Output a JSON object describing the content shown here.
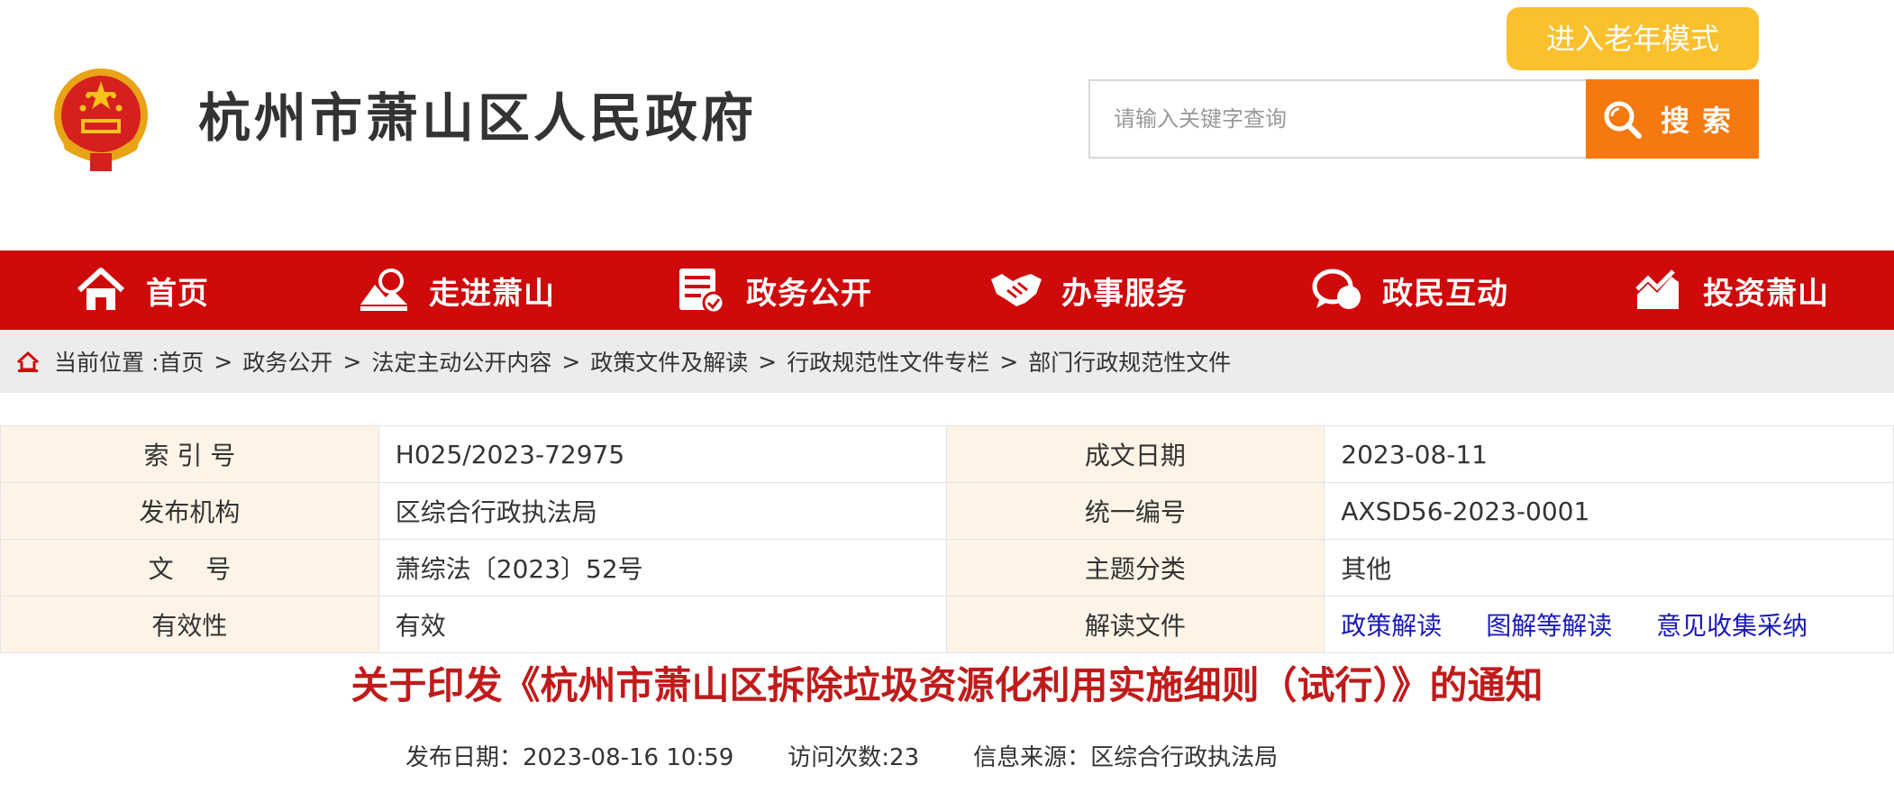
{
  "header": {
    "site_title": "杭州市萧山区人民政府",
    "elder_mode_label": "进入老年模式",
    "search_placeholder": "请输入关键字查询",
    "search_button_label": "搜索"
  },
  "nav": {
    "items": [
      {
        "label": "首页",
        "icon": "home-icon"
      },
      {
        "label": "走进萧山",
        "icon": "landscape-icon"
      },
      {
        "label": "政务公开",
        "icon": "document-check-icon"
      },
      {
        "label": "办事服务",
        "icon": "handshake-icon"
      },
      {
        "label": "政民互动",
        "icon": "chat-bubble-icon"
      },
      {
        "label": "投资萧山",
        "icon": "trend-chart-icon"
      }
    ]
  },
  "breadcrumb": {
    "prefix": "当前位置 :",
    "items": [
      "首页",
      "政务公开",
      "法定主动公开内容",
      "政策文件及解读",
      "行政规范性文件专栏",
      "部门行政规范性文件"
    ]
  },
  "info_table": {
    "index_label": "索 引 号",
    "index_value": "H025/2023-72975",
    "date_label": "成文日期",
    "date_value": "2023-08-11",
    "org_label": "发布机构",
    "org_value": "区综合行政执法局",
    "code_label": "统一编号",
    "code_value": "AXSD56-2023-0001",
    "docno_label": "文    号",
    "docno_value": "萧综法〔2023〕52号",
    "topic_label": "主题分类",
    "topic_value": "其他",
    "valid_label": "有效性",
    "valid_value": "有效",
    "interp_label": "解读文件",
    "interp_links": [
      "政策解读",
      "图解等解读",
      "意见收集采纳"
    ]
  },
  "article": {
    "title": "关于印发《杭州市萧山区拆除垃圾资源化利用实施细则（试行）》的通知",
    "publish_date": "发布日期：2023-08-16 10:59",
    "visits": "访问次数:23",
    "source": "信息来源：区综合行政执法局"
  },
  "colors": {
    "nav_red": "#cf0a0a",
    "elder_yellow": "#fbc02d",
    "search_orange": "#f5790e",
    "title_red": "#c01b1b",
    "link_blue": "#1a1ab8",
    "key_cell_bg": "#fdf4e7"
  }
}
